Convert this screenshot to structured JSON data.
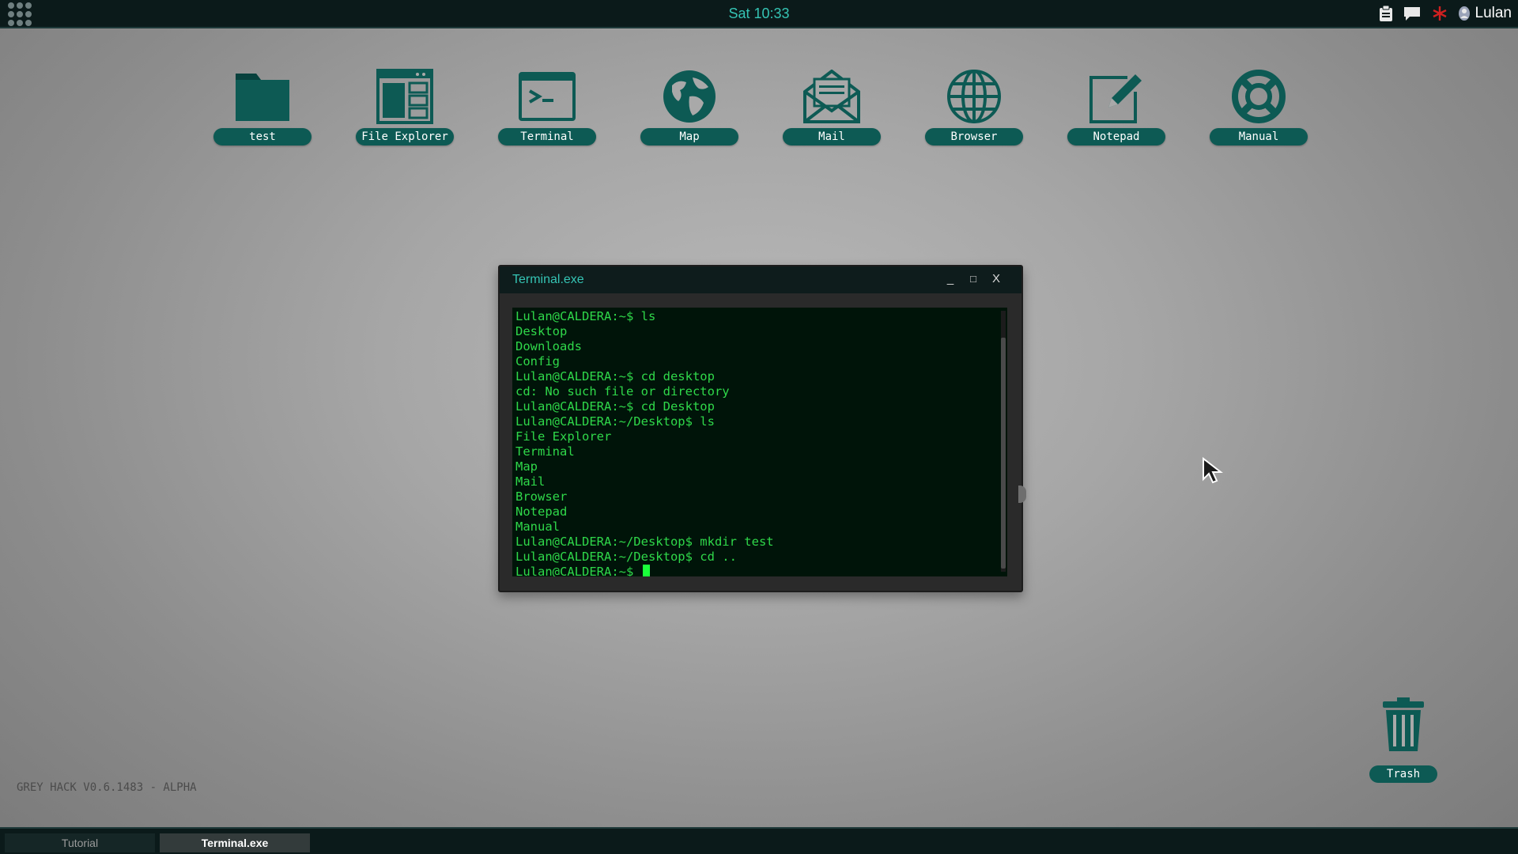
{
  "topbar": {
    "clock": "Sat 10:33",
    "user": "Lulan",
    "tray_icons": [
      "clipboard-icon",
      "chat-icon",
      "network-icon",
      "user-icon"
    ]
  },
  "desktop": {
    "icons": [
      {
        "label": "test",
        "icon": "folder-icon"
      },
      {
        "label": "File Explorer",
        "icon": "file-explorer-icon"
      },
      {
        "label": "Terminal",
        "icon": "terminal-icon"
      },
      {
        "label": "Map",
        "icon": "globe-map-icon"
      },
      {
        "label": "Mail",
        "icon": "mail-icon"
      },
      {
        "label": "Browser",
        "icon": "browser-globe-icon"
      },
      {
        "label": "Notepad",
        "icon": "notepad-icon"
      },
      {
        "label": "Manual",
        "icon": "lifebuoy-icon"
      }
    ],
    "trash_label": "Trash",
    "version": "GREY HACK V0.6.1483 - ALPHA"
  },
  "terminal_window": {
    "title": "Terminal.exe",
    "controls": {
      "minimize": "_",
      "maximize": "□",
      "close": "X"
    },
    "lines": [
      "Lulan@CALDERA:~$ ls",
      "Desktop",
      "Downloads",
      "Config",
      "Lulan@CALDERA:~$ cd desktop",
      "cd: No such file or directory",
      "Lulan@CALDERA:~$ cd Desktop",
      "Lulan@CALDERA:~/Desktop$ ls",
      "File Explorer",
      "Terminal",
      "Map",
      "Mail",
      "Browser",
      "Notepad",
      "Manual",
      "Lulan@CALDERA:~/Desktop$ mkdir test",
      "Lulan@CALDERA:~/Desktop$ cd .."
    ],
    "prompt": "Lulan@CALDERA:~$ "
  },
  "taskbar": {
    "tasks": [
      {
        "label": "Tutorial",
        "active": false
      },
      {
        "label": "Terminal.exe",
        "active": true
      }
    ]
  },
  "colors": {
    "accent": "#35c4b4",
    "icon": "#0d5a54",
    "terminal_text": "#2fd84a",
    "terminal_bg": "#001409",
    "bar_bg": "#0b1a1a"
  }
}
